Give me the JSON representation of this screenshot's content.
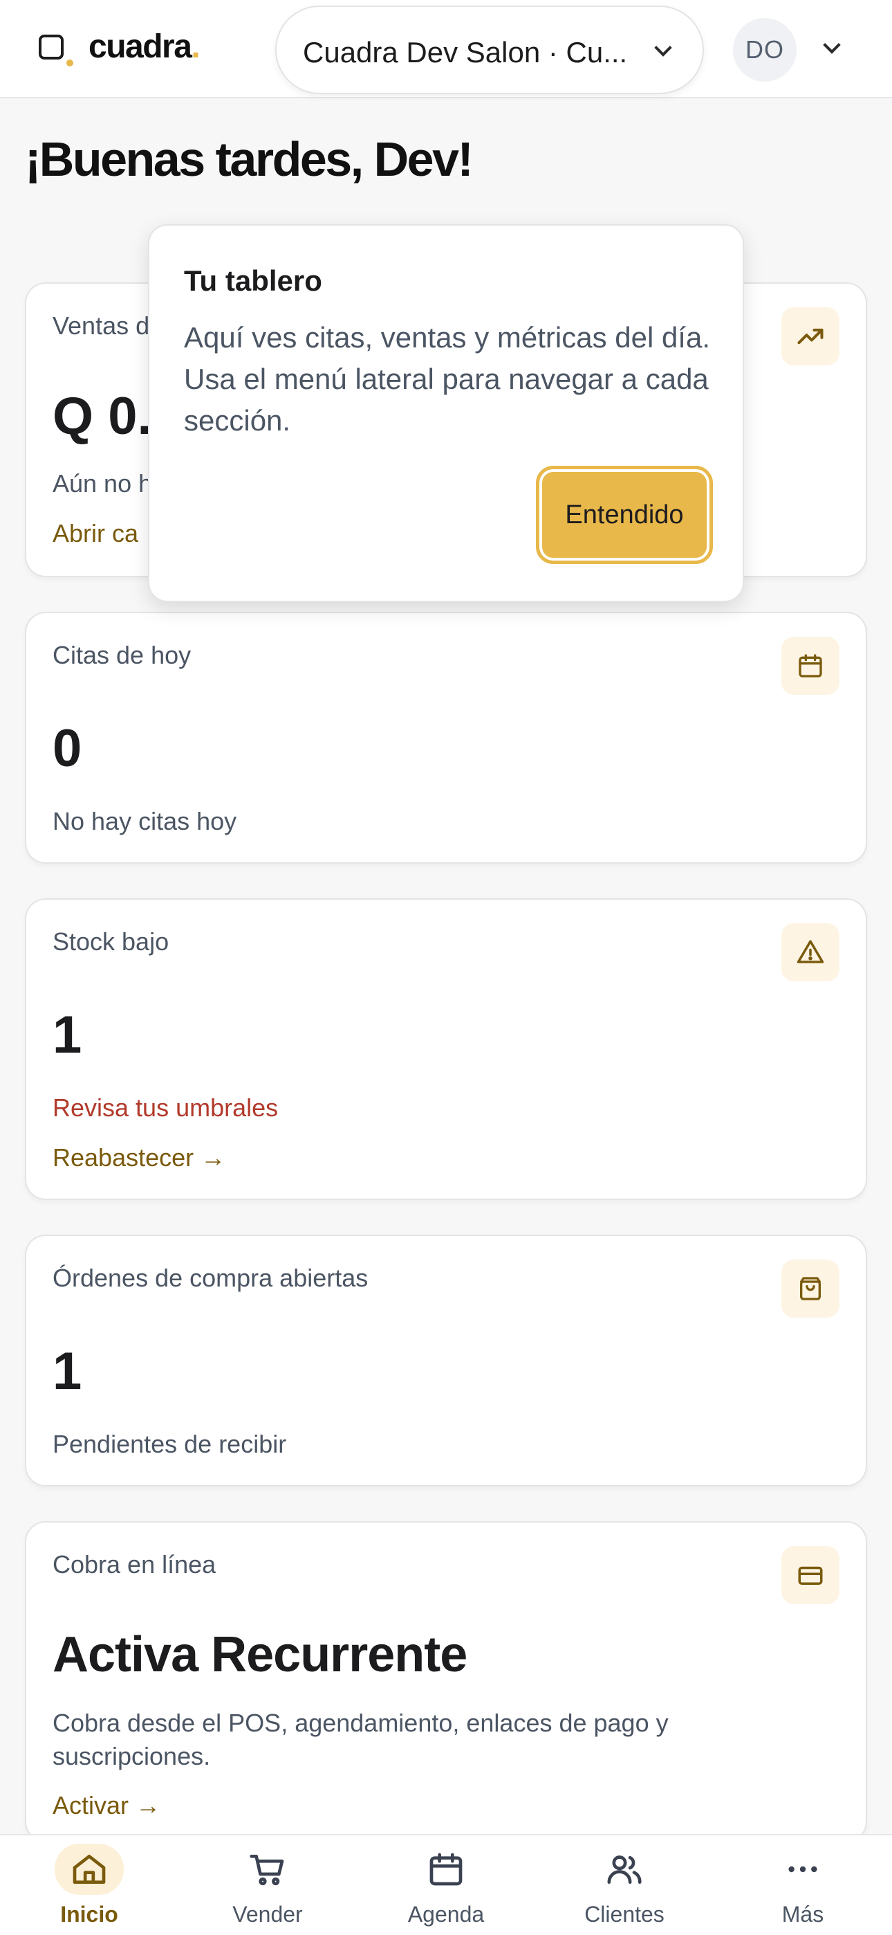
{
  "header": {
    "logo_text": "cuadra",
    "logo_dot": ".",
    "salon_selector_label": "Cuadra Dev Salon · Cu...",
    "avatar_initials": "DO"
  },
  "greeting": "¡Buenas tardes, Dev!",
  "cards": {
    "sales": {
      "title": "Ventas d",
      "value": "Q 0.",
      "subtitle": "Aún no h",
      "link": "Abrir ca"
    },
    "appointments": {
      "title": "Citas de hoy",
      "value": "0",
      "subtitle": "No hay citas hoy"
    },
    "stock": {
      "title": "Stock bajo",
      "value": "1",
      "warning": "Revisa tus umbrales",
      "link": "Reabastecer →"
    },
    "purchase_orders": {
      "title": "Órdenes de compra abiertas",
      "value": "1",
      "subtitle": "Pendientes de recibir"
    },
    "online_payments": {
      "title": "Cobra en línea",
      "value": "Activa Recurrente",
      "subtitle": "Cobra desde el POS, agendamiento, enlaces de pago y suscripciones.",
      "link": "Activar →"
    }
  },
  "popover": {
    "title": "Tu tablero",
    "body": "Aquí ves citas, ventas y métricas del día. Usa el menú lateral para navegar a cada sección.",
    "button_label": "Entendido"
  },
  "bottom_nav": {
    "active": "Inicio",
    "items": [
      {
        "label": "Inicio",
        "icon": "home-icon"
      },
      {
        "label": "Vender",
        "icon": "cart-icon"
      },
      {
        "label": "Agenda",
        "icon": "calendar-icon"
      },
      {
        "label": "Clientes",
        "icon": "users-icon"
      },
      {
        "label": "Más",
        "icon": "more-icon"
      }
    ]
  },
  "colors": {
    "accent": "#e8b84a",
    "accent_text": "#7a5a0c",
    "warning": "#b23a2b",
    "icon_bg": "#fdf4e3"
  }
}
